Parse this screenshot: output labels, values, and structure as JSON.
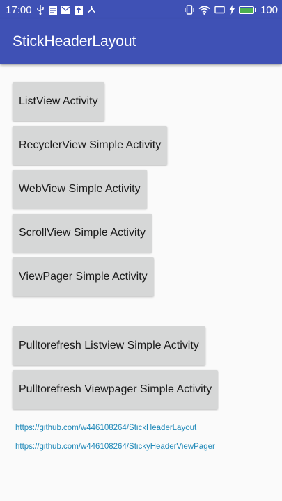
{
  "status_bar": {
    "time": "17:00",
    "battery": "100",
    "icons": [
      "usb-icon",
      "note-icon",
      "mail-icon",
      "upload-icon",
      "share-icon",
      "vibrate-icon",
      "wifi-icon",
      "screen-icon",
      "charging-icon",
      "battery-icon"
    ]
  },
  "app_bar": {
    "title": "StickHeaderLayout"
  },
  "buttons": [
    {
      "label": "ListView Activity"
    },
    {
      "label": "RecyclerView Simple Activity"
    },
    {
      "label": "WebView Simple Activity"
    },
    {
      "label": "ScrollView Simple Activity"
    },
    {
      "label": "ViewPager Simple Activity"
    },
    {
      "label": "Pulltorefresh Listview Simple Activity"
    },
    {
      "label": "Pulltorefresh Viewpager Simple Activity"
    }
  ],
  "links": [
    {
      "text": "https://github.com/w446108264/StickHeaderLayout"
    },
    {
      "text": "https://github.com/w446108264/StickyHeaderViewPager"
    }
  ],
  "colors": {
    "primary": "#3f51b5",
    "button_bg": "#d6d7d7",
    "link": "#1e88b8",
    "battery": "#4caf50"
  }
}
